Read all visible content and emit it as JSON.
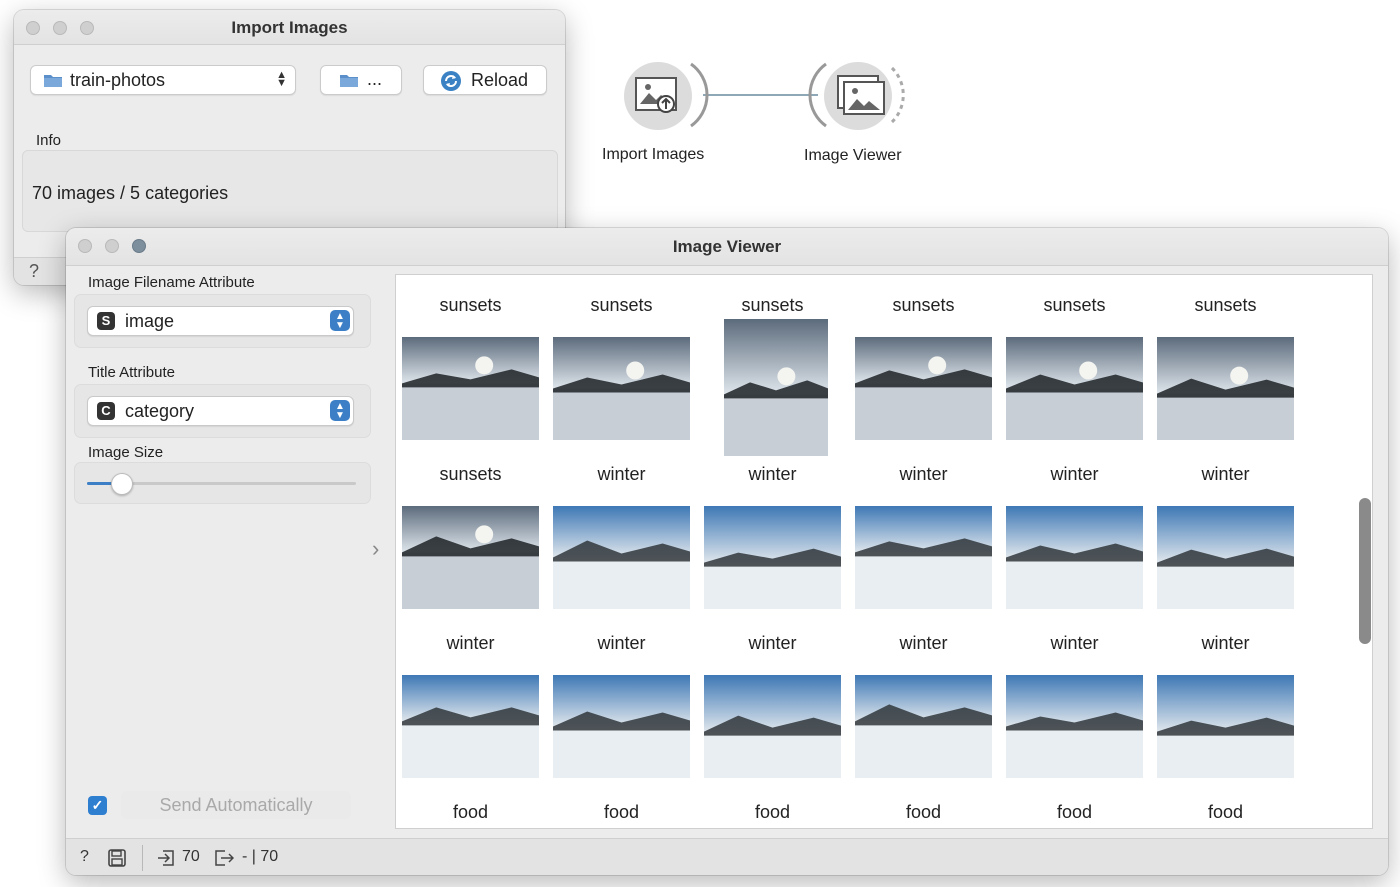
{
  "import_window": {
    "title": "Import Images",
    "directory": "train-photos",
    "browse_label": "...",
    "reload_label": "Reload",
    "info_label": "Info",
    "info_text": "70 images / 5 categories",
    "help_icon": "?"
  },
  "canvas": {
    "import_node_label": "Import Images",
    "viewer_node_label": "Image Viewer"
  },
  "viewer_window": {
    "title": "Image Viewer",
    "filename_attr_label": "Image Filename Attribute",
    "filename_attr_type": "S",
    "filename_attr_value": "image",
    "title_attr_label": "Title Attribute",
    "title_attr_type": "C",
    "title_attr_value": "category",
    "image_size_label": "Image Size",
    "image_size_level": 0.1,
    "send_auto_checked": true,
    "send_auto_label": "Send Automatically",
    "status": {
      "help": "?",
      "input_count": "70",
      "output_count": "- | 70"
    }
  },
  "grid_rows": [
    [
      "sunsets",
      "sunsets",
      "sunsets",
      "sunsets",
      "sunsets",
      "sunsets"
    ],
    [
      "sunsets",
      "winter",
      "winter",
      "winter",
      "winter",
      "winter"
    ],
    [
      "winter",
      "winter",
      "winter",
      "winter",
      "winter",
      "winter"
    ],
    [
      "food",
      "food",
      "food",
      "food",
      "food",
      "food"
    ]
  ],
  "colors": {
    "accent": "#3d7fc6",
    "checkbox": "#2f7fd1",
    "link": "#8fa8b8"
  }
}
